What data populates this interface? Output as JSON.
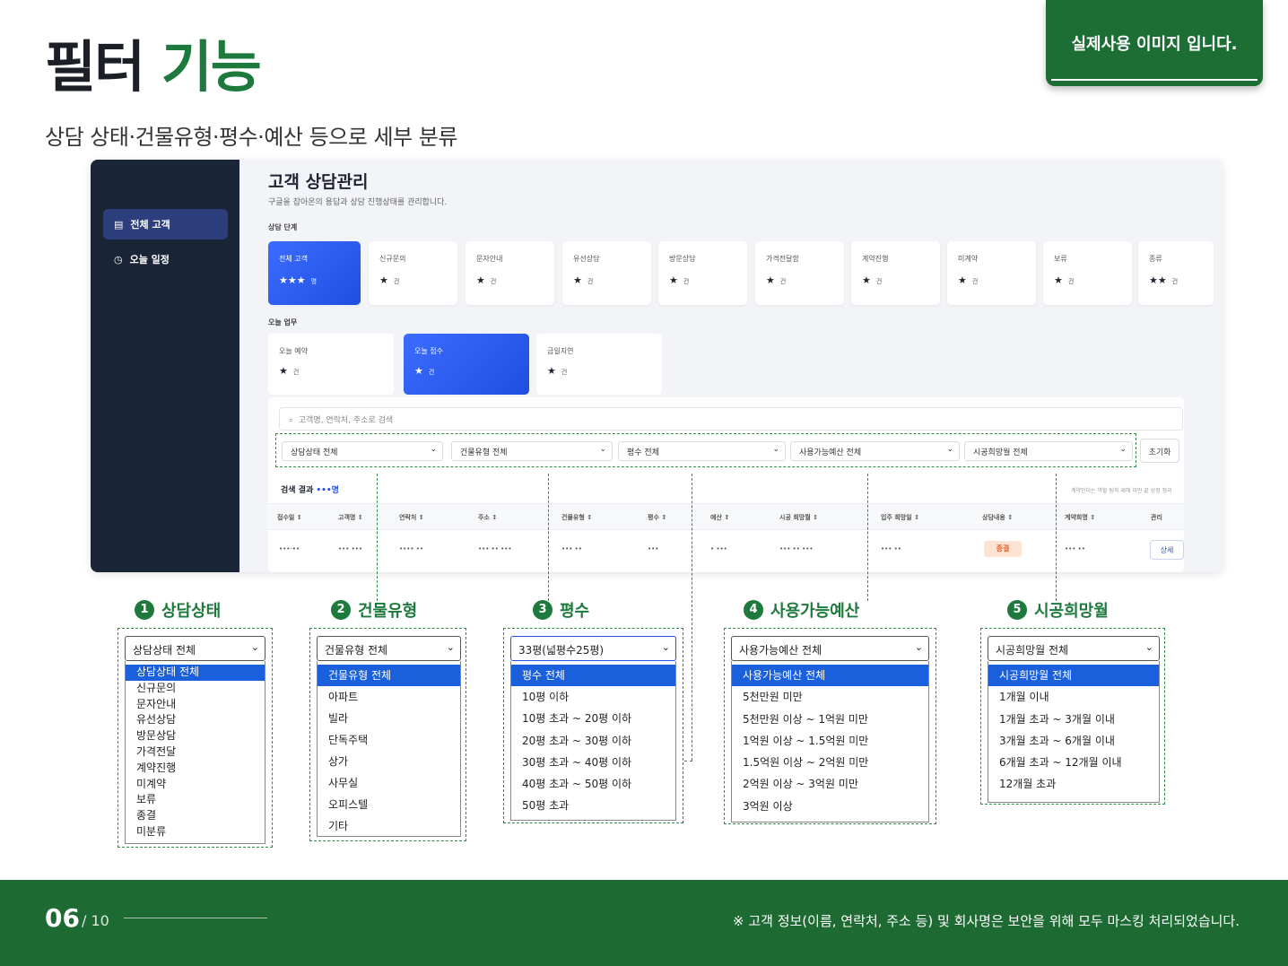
{
  "header": {
    "title_main": "필터",
    "title_accent": "기능",
    "subtitle": "상담 상태·건물유형·평수·예산 등으로 세부 분류",
    "badge": "실제사용 이미지 입니다."
  },
  "sidebar": {
    "items": [
      {
        "label": "전체 고객",
        "icon": "list-icon"
      },
      {
        "label": "오늘 일정",
        "icon": "clock-icon"
      }
    ]
  },
  "main": {
    "title": "고객 상담관리",
    "description": "구글을 잡아온의 용답과 상담 진행상태를 관리합니다.",
    "stage_label": "상담 단계",
    "stage_cards": [
      {
        "label": "전체 고객",
        "value": "★★★",
        "unit": "명"
      },
      {
        "label": "신규문의",
        "value": "★",
        "unit": "건"
      },
      {
        "label": "문자안내",
        "value": "★",
        "unit": "건"
      },
      {
        "label": "유선상담",
        "value": "★",
        "unit": "건"
      },
      {
        "label": "방문상담",
        "value": "★",
        "unit": "건"
      },
      {
        "label": "가격전달함",
        "value": "★",
        "unit": "건"
      },
      {
        "label": "계약진행",
        "value": "★",
        "unit": "건"
      },
      {
        "label": "미계약",
        "value": "★",
        "unit": "건"
      },
      {
        "label": "보류",
        "value": "★",
        "unit": "건"
      },
      {
        "label": "종류",
        "value": "★★",
        "unit": "건"
      }
    ],
    "today_label": "오늘 업무",
    "today_cards": [
      {
        "label": "오늘 예약",
        "value": "★",
        "unit": "건"
      },
      {
        "label": "오늘 접수",
        "value": "★",
        "unit": "건"
      },
      {
        "label": "금일지연",
        "value": "★",
        "unit": "건"
      }
    ],
    "search_placeholder": "고객명, 연락처, 주소로 검색",
    "filters": [
      "상담상태 전체",
      "건물유형 전체",
      "평수 전체",
      "사용가능예산 전체",
      "시공희망월 전체"
    ],
    "reset_label": "초기화",
    "result_label": "검색 결과",
    "result_count": "•••명",
    "result_note": "계약인이는 역할 팀직 재해 미만 끝 상정 정리",
    "columns": [
      "접수일 ↕",
      "고객명 ↕",
      "연락처 ↕",
      "주소 ↕",
      "건물유형 ↕",
      "평수 ↕",
      "예산 ↕",
      "시공 희망월 ↕",
      "입주 희망일 ↕",
      "상담내용 ↕",
      "계약희명 ↕",
      "관리"
    ],
    "row": [
      "•••-••",
      "••• •••",
      "•••• ••",
      "••• •• •••",
      "••• ••",
      "•••",
      "• •••",
      "••• •• •••",
      "••• ••",
      "종결",
      "••• ••",
      "상세"
    ]
  },
  "callouts": [
    {
      "num": "1",
      "title": "상담상태",
      "selected": "상담상태 전체",
      "options": [
        "상담상태 전체",
        "신규문의",
        "문자안내",
        "유선상담",
        "방문상담",
        "가격전달",
        "계약진행",
        "미계약",
        "보류",
        "종결",
        "미분류"
      ]
    },
    {
      "num": "2",
      "title": "건물유형",
      "selected": "건물유형 전체",
      "options": [
        "건물유형 전체",
        "아파트",
        "빌라",
        "단독주택",
        "상가",
        "사무실",
        "오피스텔",
        "기타"
      ]
    },
    {
      "num": "3",
      "title": "평수",
      "selected": "33평(넓평수25평)",
      "options": [
        "평수 전체",
        "10평 이하",
        "10평 초과 ~ 20평 이하",
        "20평 초과 ~ 30평 이하",
        "30평 초과 ~ 40평 이하",
        "40평 초과 ~ 50평 이하",
        "50평 초과"
      ]
    },
    {
      "num": "4",
      "title": "사용가능예산",
      "selected": "사용가능예산 전체",
      "options": [
        "사용가능예산 전체",
        "5천만원 미만",
        "5천만원 이상 ~ 1억원 미만",
        "1억원 이상 ~ 1.5억원 미만",
        "1.5억원 이상 ~ 2억원 미만",
        "2억원 이상 ~ 3억원 미만",
        "3억원 이상"
      ]
    },
    {
      "num": "5",
      "title": "시공희망월",
      "selected": "시공희망월 전체",
      "options": [
        "시공희망월 전체",
        "1개월 이내",
        "1개월 초과 ~ 3개월 이내",
        "3개월 초과 ~ 6개월 이내",
        "6개월 초과 ~ 12개월 이내",
        "12개월 초과"
      ]
    }
  ],
  "footer": {
    "page": "06",
    "total": "/ 10",
    "note": "※ 고객 정보(이름, 연락처, 주소 등) 및 회사명은 보안을 위해 모두 마스킹 처리되었습니다."
  },
  "colors": {
    "accent_green": "#1e7a3c",
    "accent_blue": "#2350e6",
    "sidebar": "#1b2538",
    "footer": "#1e6a33"
  }
}
